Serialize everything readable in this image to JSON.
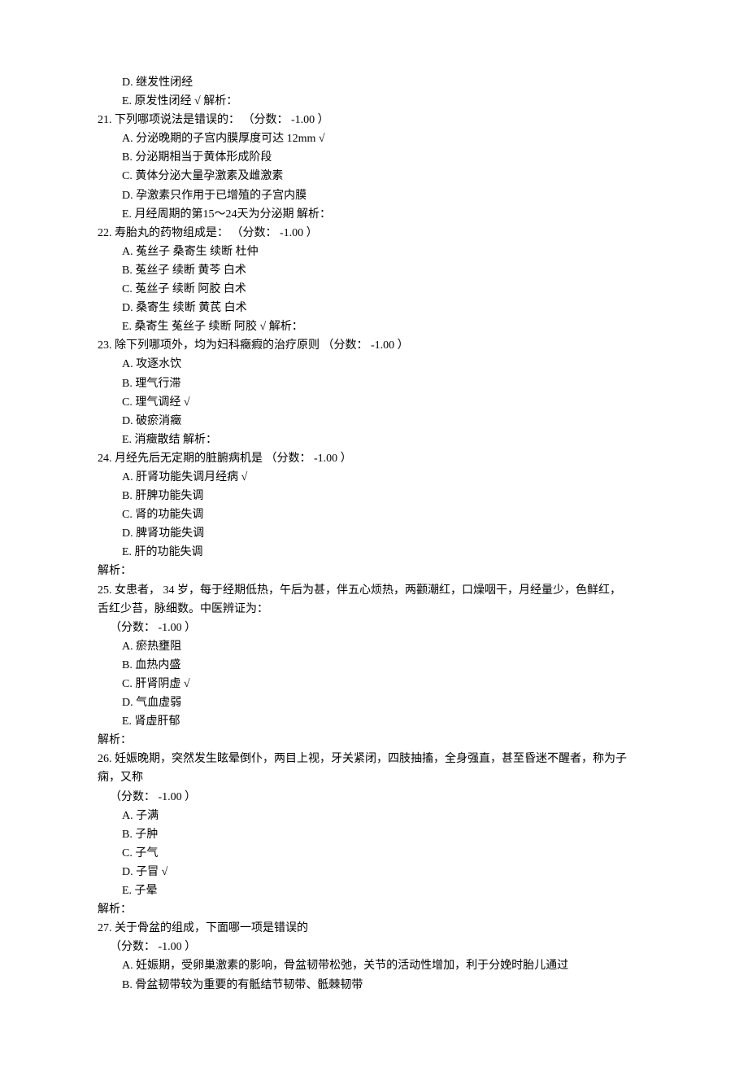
{
  "items": [
    {
      "type": "option_tail",
      "options": [
        {
          "letter": "D",
          "text": "继发性闭经",
          "checked": false
        },
        {
          "letter": "E",
          "text": "原发性闭经",
          "checked": true,
          "suffix": "解析："
        }
      ]
    },
    {
      "type": "question",
      "num": "21",
      "stem": "下列哪项说法是错误的：",
      "score": "（分数： -1.00 ）",
      "options": [
        {
          "letter": "A",
          "text": "分泌晚期的子宫内膜厚度可达 12mm",
          "checked": true
        },
        {
          "letter": "B",
          "text": "分泌期相当于黄体形成阶段",
          "checked": false
        },
        {
          "letter": "C",
          "text": "黄体分泌大量孕激素及雌激素",
          "checked": false
        },
        {
          "letter": "D",
          "text": "孕激素只作用于已增殖的子宫内膜",
          "checked": false
        },
        {
          "letter": "E",
          "text": "月经周期的第15～24天为分泌期 解析：",
          "checked": false
        }
      ]
    },
    {
      "type": "question",
      "num": "22",
      "stem": "寿胎丸的药物组成是：",
      "score": "（分数： -1.00 ）",
      "options": [
        {
          "letter": "A",
          "text": "菟丝子 桑寄生 续断 杜仲",
          "checked": false
        },
        {
          "letter": "B",
          "text": "菟丝子 续断 黄芩 白术",
          "checked": false
        },
        {
          "letter": "C",
          "text": "菟丝子 续断 阿胶 白术",
          "checked": false
        },
        {
          "letter": "D",
          "text": "桑寄生 续断 黄芪 白术",
          "checked": false
        },
        {
          "letter": "E",
          "text": "桑寄生 菟丝子 续断 阿胶",
          "checked": true,
          "suffix": "解析："
        }
      ]
    },
    {
      "type": "question",
      "num": "23",
      "stem": "除下列哪项外，均为妇科癥瘕的治疗原则",
      "score": "（分数： -1.00 ）",
      "options": [
        {
          "letter": "A",
          "text": "攻逐水饮",
          "checked": false
        },
        {
          "letter": "B",
          "text": "理气行滞",
          "checked": false
        },
        {
          "letter": "C",
          "text": "理气调经",
          "checked": true
        },
        {
          "letter": "D",
          "text": "破瘀消癥",
          "checked": false
        },
        {
          "letter": "E",
          "text": "消癥散结 解析：",
          "checked": false
        }
      ]
    },
    {
      "type": "question",
      "num": "24",
      "stem": "月经先后无定期的脏腑病机是",
      "score": "（分数： -1.00 ）",
      "options": [
        {
          "letter": "A",
          "text": "肝肾功能失调月经病",
          "checked": true
        },
        {
          "letter": "B",
          "text": "肝脾功能失调",
          "checked": false
        },
        {
          "letter": "C",
          "text": "肾的功能失调",
          "checked": false
        },
        {
          "letter": "D",
          "text": "脾肾功能失调",
          "checked": false
        },
        {
          "letter": "E",
          "text": "肝的功能失调",
          "checked": false
        }
      ],
      "tail": "解析："
    },
    {
      "type": "question_long",
      "num": "25",
      "stem_lines": [
        "女患者， 34 岁，每于经期低热，午后为甚，伴五心烦热，两颧潮红，口燥咽干，月经量少，色鲜红，",
        "舌红少苔，脉细数。中医辨证为："
      ],
      "score": "（分数： -1.00 ）",
      "options": [
        {
          "letter": "A",
          "text": "瘀热壅阻",
          "checked": false
        },
        {
          "letter": "B",
          "text": "血热内盛",
          "checked": false
        },
        {
          "letter": "C",
          "text": "肝肾阴虚",
          "checked": true
        },
        {
          "letter": "D",
          "text": "气血虚弱",
          "checked": false
        },
        {
          "letter": "E",
          "text": "肾虚肝郁",
          "checked": false
        }
      ],
      "tail": "解析："
    },
    {
      "type": "question_long",
      "num": "26",
      "stem_lines": [
        "妊娠晚期，突然发生眩晕倒仆，两目上视，牙关紧闭，四肢抽搐，全身强直，甚至昏迷不醒者，称为子",
        "痫，又称"
      ],
      "score": "（分数： -1.00 ）",
      "options": [
        {
          "letter": "A",
          "text": "子满",
          "checked": false
        },
        {
          "letter": "B",
          "text": "子肿",
          "checked": false
        },
        {
          "letter": "C",
          "text": "子气",
          "checked": false
        },
        {
          "letter": "D",
          "text": "子冒",
          "checked": true
        },
        {
          "letter": "E",
          "text": "子晕",
          "checked": false
        }
      ],
      "tail": "解析："
    },
    {
      "type": "question_partial",
      "num": "27",
      "stem": "关于骨盆的组成，下面哪一项是错误的",
      "score": "（分数： -1.00 ）",
      "options": [
        {
          "letter": "A",
          "text": "妊娠期，受卵巢激素的影响，骨盆韧带松弛，关节的活动性增加，利于分娩时胎儿通过",
          "checked": false
        },
        {
          "letter": "B",
          "text": "骨盆韧带较为重要的有骶结节韧带、骶棘韧带",
          "checked": false
        }
      ]
    }
  ],
  "check_mark": "√"
}
